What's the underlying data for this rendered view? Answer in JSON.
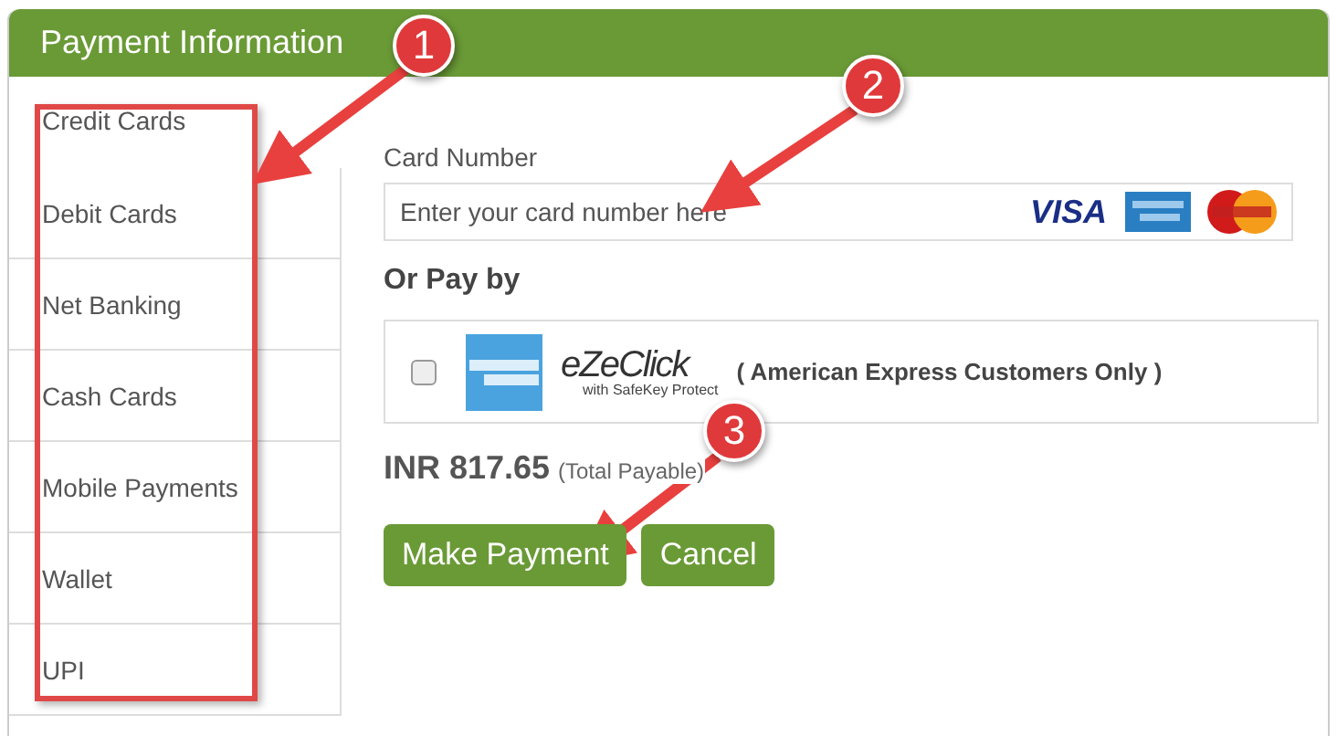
{
  "header": {
    "title": "Payment Information"
  },
  "sidebar": {
    "items": [
      {
        "label": "Credit Cards",
        "selected": true
      },
      {
        "label": "Debit Cards",
        "selected": false
      },
      {
        "label": "Net Banking",
        "selected": false
      },
      {
        "label": "Cash Cards",
        "selected": false
      },
      {
        "label": "Mobile Payments",
        "selected": false
      },
      {
        "label": "Wallet",
        "selected": false
      },
      {
        "label": "UPI",
        "selected": false
      }
    ]
  },
  "card_number": {
    "label": "Card Number",
    "placeholder": "Enter your card number here",
    "visa_logo": "VISA"
  },
  "alt_payment": {
    "heading": "Or Pay by",
    "option": {
      "checked": false,
      "logo_text": "eZeClick",
      "logo_subtext": "with SafeKey Protect",
      "note": "( American Express Customers Only )"
    }
  },
  "total": {
    "amount": "INR 817.65",
    "note": "(Total Payable)"
  },
  "buttons": [
    {
      "label": "Make Payment"
    },
    {
      "label": "Cancel"
    }
  ],
  "annotations": [
    {
      "number": "1"
    },
    {
      "number": "2"
    },
    {
      "number": "3"
    }
  ]
}
